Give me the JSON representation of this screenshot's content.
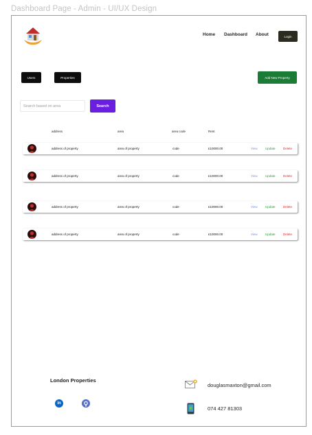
{
  "frame_title": "Dashboard Page - Admin - UI/UX Design",
  "nav": {
    "home": "Home",
    "dashboard": "Dashboard",
    "about": "About",
    "login": "Login"
  },
  "tabs": {
    "users": "Users",
    "properties": "Properties"
  },
  "add_property": "Add New Property",
  "search": {
    "placeholder": "Search based on area",
    "button": "Search"
  },
  "table": {
    "columns": [
      "address",
      "area",
      "area code",
      "Rent"
    ],
    "rows": [
      {
        "address": "address of property",
        "area": "area of property",
        "code": "code",
        "rent": "£10000.00",
        "view": "View",
        "update": "Update",
        "delete": "Delete"
      },
      {
        "address": "address of property",
        "area": "area of property",
        "code": "code",
        "rent": "£10000.00",
        "view": "View",
        "update": "Update",
        "delete": "Delete"
      },
      {
        "address": "address of property",
        "area": "area of property",
        "code": "code",
        "rent": "£10000.00",
        "view": "View",
        "update": "Update",
        "delete": "Delete"
      },
      {
        "address": "address of property",
        "area": "area of property",
        "code": "code",
        "rent": "£10000.00",
        "view": "View",
        "update": "Update",
        "delete": "Delete"
      }
    ]
  },
  "footer": {
    "title": "London Properties",
    "email": "douglasmaxton@gmail.com",
    "phone": "074 427 81303",
    "linkedin_icon": "linkedin-icon",
    "github_icon": "github-icon"
  },
  "colors": {
    "login": "#2b2b20",
    "add_property": "#1b7d35",
    "search_button": "#6a1fe0",
    "view": "#7a8fd6",
    "update": "#2e9a3c",
    "delete": "#d42a2a"
  }
}
